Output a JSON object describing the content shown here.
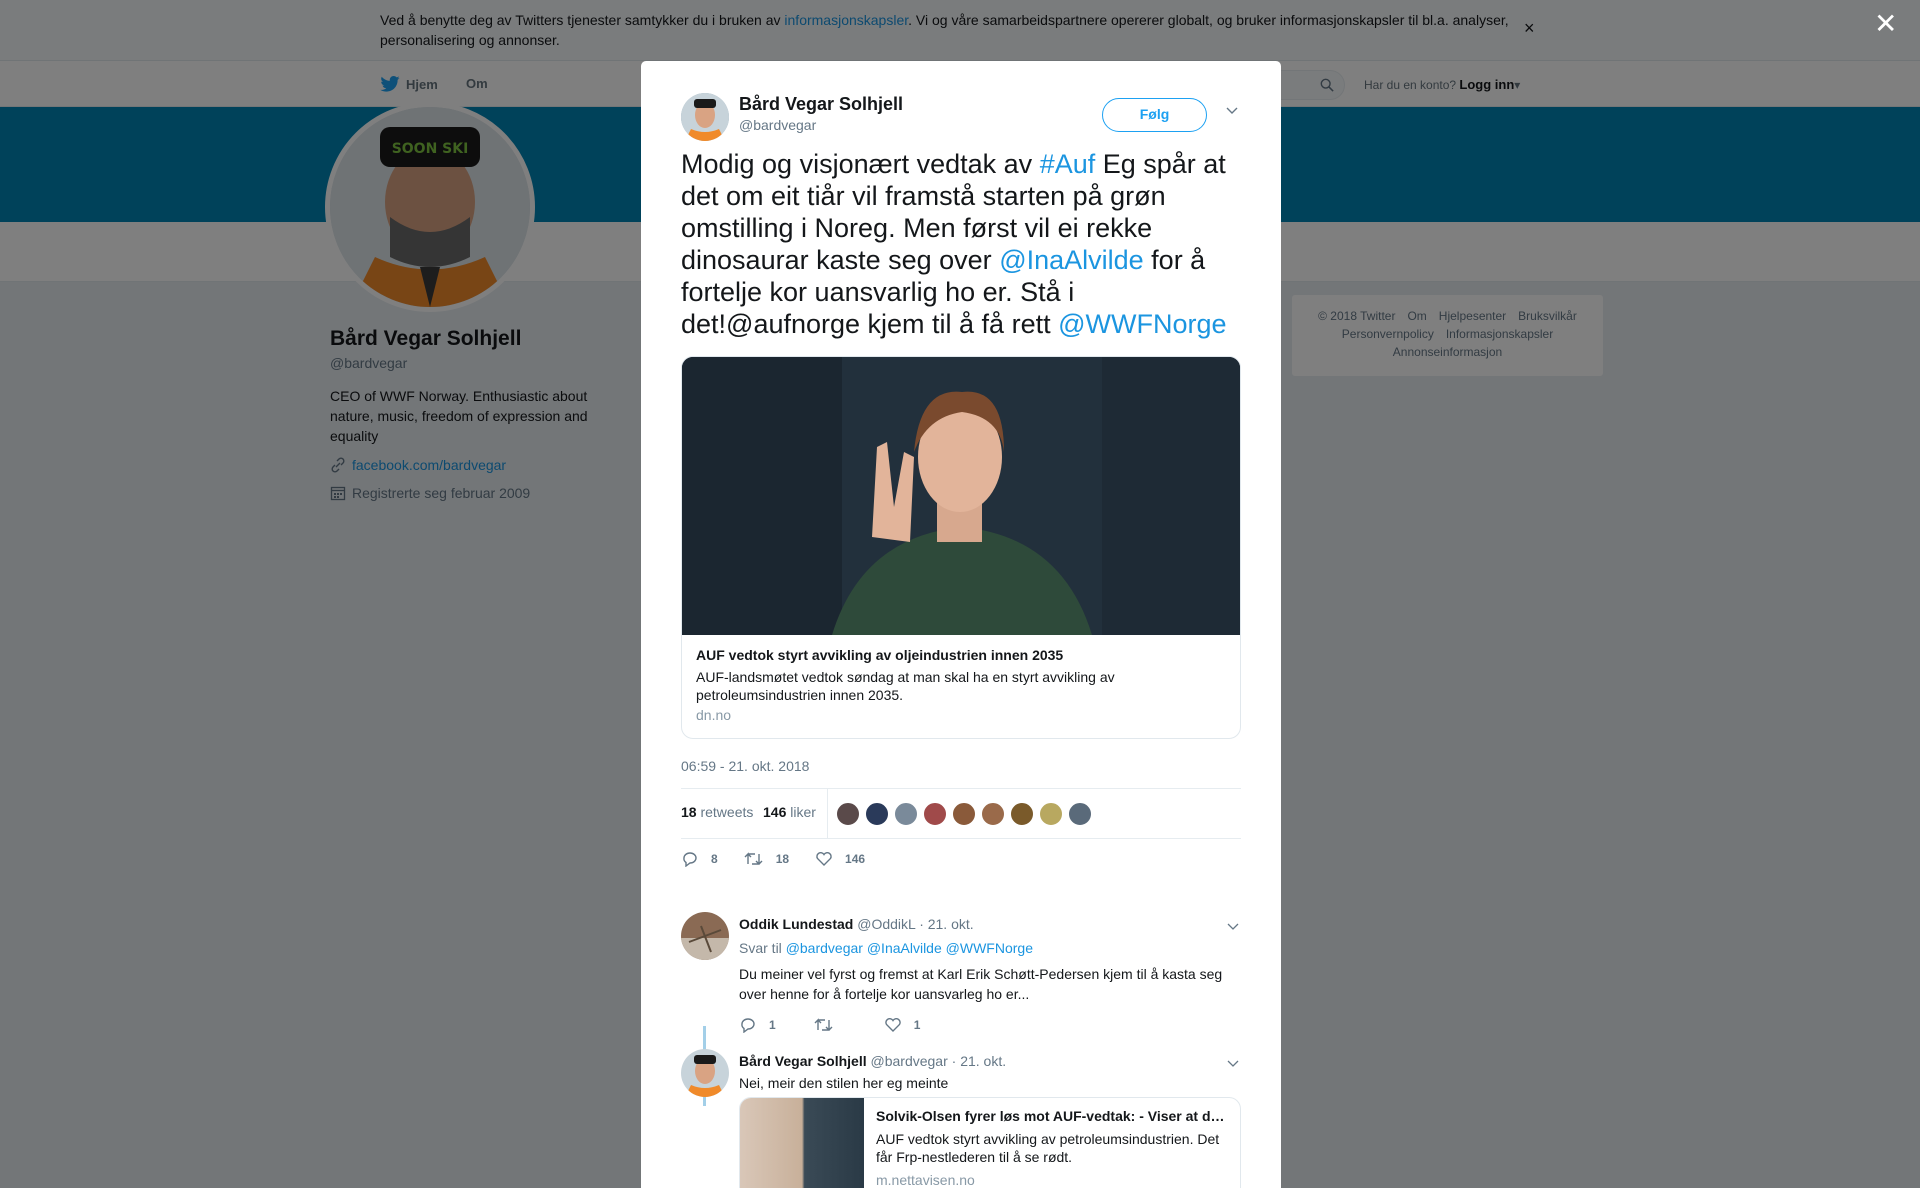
{
  "cookie_banner": {
    "text_before": "Ved å benytte deg av Twitters tjenester samtykker du i bruken av ",
    "link": "informasjonskapsler",
    "text_after": ". Vi og våre samarbeidspartnere opererer globalt, og bruker informasjonskapsler til bl.a. analyser, personalisering og annonser.",
    "close": "×"
  },
  "topnav": {
    "home": "Hjem",
    "about": "Om",
    "account_prompt": "Har du en konto?",
    "login": "Logg inn"
  },
  "profile": {
    "name": "Bård Vegar Solhjell",
    "handle": "@bardvegar",
    "bio": "CEO of WWF Norway. Enthusiastic about nature, music, freedom of expression and equality",
    "link": "facebook.com/bardvegar",
    "joined": "Registrerte seg februar 2009",
    "hat_text": "SOON SKI"
  },
  "footer": {
    "items": [
      "© 2018 Twitter",
      "Om",
      "Hjelpesenter",
      "Bruksvilkår",
      "Personvernpolicy",
      "Informasjonskapsler",
      "Annonseinformasjon"
    ]
  },
  "overlay_close": "✕",
  "tweet": {
    "name": "Bård Vegar Solhjell",
    "handle": "@bardvegar",
    "follow": "Følg",
    "text_1": "Modig og visjonært vedtak av ",
    "tag_auf": "#Auf",
    "text_2": " Eg spår at det om eit tiår vil framstå starten på grøn omstilling i Noreg. Men først vil ei rekke dinosaurar kaste seg over ",
    "mention_ina": "@InaAlvilde",
    "text_3": " for å fortelje kor uansvarlig ho er. Stå i det!@aufnorge kjem til å få rett ",
    "mention_wwf": "@WWFNorge",
    "card": {
      "title": "AUF vedtok styrt avvikling av oljeindustrien innen 2035",
      "description": "AUF-landsmøtet vedtok søndag at man skal ha en styrt avvikling av petroleumsindustrien innen 2035.",
      "domain": "dn.no"
    },
    "timestamp": "06:59 - 21. okt. 2018",
    "retweets_count": "18",
    "retweets_label": "retweets",
    "likes_count": "146",
    "likes_label": "liker",
    "likers": [
      "#5a4a4a",
      "#2a3a5a",
      "#7a8a9a",
      "#a04a4a",
      "#8a5a3a",
      "#9a6a4a",
      "#7a5a2a",
      "#b8a860",
      "#5a6a7a"
    ],
    "actions": {
      "replies": "8",
      "retweets": "18",
      "likes": "146"
    }
  },
  "replies": [
    {
      "name": "Oddik Lundestad",
      "handle": "@OddikL",
      "date": "· 21. okt.",
      "reply_to_label": "Svar til",
      "reply_to": [
        "@bardvegar",
        "@InaAlvilde",
        "@WWFNorge"
      ],
      "text": "Du meiner vel fyrst og fremst at Karl Erik Schøtt-Pedersen kjem til å kasta seg over henne for å fortelje kor uansvarleg ho er...",
      "actions": {
        "replies": "1",
        "retweets": "",
        "likes": "1"
      }
    },
    {
      "name": "Bård Vegar Solhjell",
      "handle": "@bardvegar",
      "date": "· 21. okt.",
      "text": "Nei, meir den stilen her eg meinte",
      "card": {
        "title": "Solvik-Olsen fyrer løs mot AUF-vedtak: - Viser at de ...",
        "description": "AUF vedtok styrt avvikling av petroleumsindustrien. Det får Frp-nestlederen til å se rødt.",
        "domain": "m.nettavisen.no"
      }
    }
  ]
}
